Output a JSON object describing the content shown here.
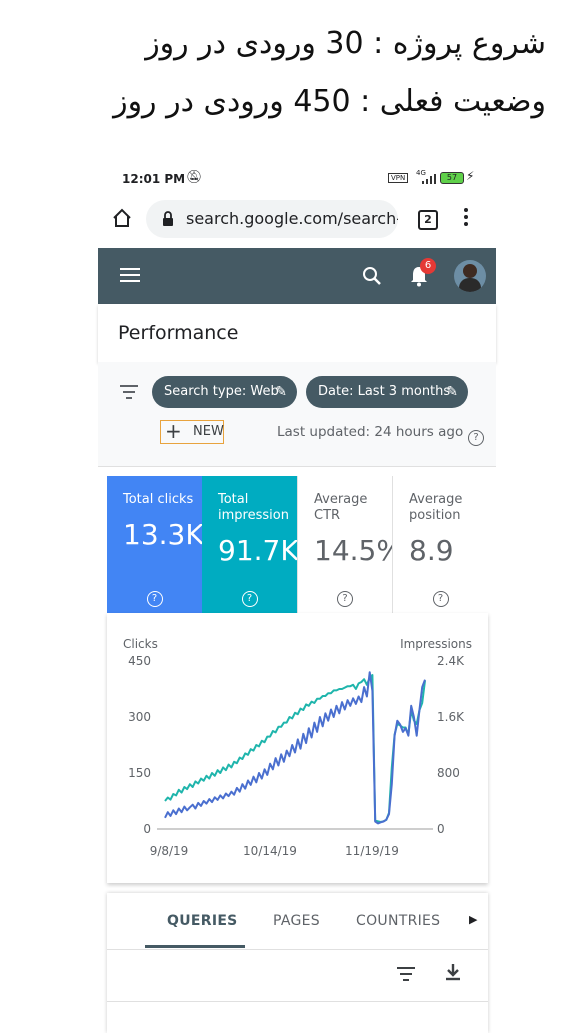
{
  "caption": {
    "line1": "شروع پروژه : 30 ورودی در روز",
    "line2": "وضعیت فعلی : 450  ورودی در روز"
  },
  "status": {
    "time": "12:01 PM",
    "battery": "57",
    "vpn": "VPN",
    "net": "4G"
  },
  "browser": {
    "url": "search.google.com/search-",
    "tab_count": "2"
  },
  "appbar": {
    "notification_count": "6"
  },
  "page": {
    "title": "Performance"
  },
  "filters": {
    "search_type": "Search type: Web",
    "date": "Date: Last 3 months",
    "new_label": "NEW",
    "last_updated": "Last updated: 24 hours ago"
  },
  "metrics": [
    {
      "label": "Total clicks",
      "value": "13.3K",
      "bg": "#4285f4",
      "fg": "#ffffff"
    },
    {
      "label": "Total impression",
      "value": "91.7K",
      "bg": "#00acc1",
      "fg": "#ffffff"
    },
    {
      "label": "Average CTR",
      "value": "14.5%",
      "bg": "#ffffff",
      "fg": "#5f6368"
    },
    {
      "label": "Average position",
      "value": "8.9",
      "bg": "#ffffff",
      "fg": "#5f6368"
    }
  ],
  "chart_data": {
    "type": "line",
    "ylabel_left": "Clicks",
    "ylabel_right": "Impressions",
    "left_ticks": [
      "450",
      "300",
      "150",
      "0"
    ],
    "right_ticks": [
      "2.4K",
      "1.6K",
      "800",
      "0"
    ],
    "x_ticks": [
      "9/8/19",
      "10/14/19",
      "11/19/19"
    ],
    "ylim_left": [
      0,
      450
    ],
    "ylim_right": [
      0,
      2400
    ],
    "series": [
      {
        "name": "Clicks",
        "color": "#4a6fcf",
        "axis": "left",
        "values": [
          30,
          45,
          35,
          50,
          40,
          55,
          45,
          60,
          50,
          58,
          65,
          55,
          70,
          62,
          75,
          68,
          80,
          72,
          85,
          78,
          90,
          82,
          95,
          88,
          100,
          92,
          110,
          100,
          120,
          108,
          130,
          118,
          140,
          125,
          150,
          135,
          160,
          145,
          175,
          160,
          190,
          170,
          200,
          180,
          210,
          195,
          225,
          205,
          240,
          215,
          255,
          230,
          270,
          245,
          285,
          260,
          300,
          275,
          310,
          290,
          320,
          300,
          330,
          310,
          340,
          320,
          345,
          330,
          350,
          335,
          355,
          340,
          380,
          355,
          420,
          370,
          20,
          15,
          18,
          20,
          25,
          40,
          120,
          250,
          290,
          280,
          260,
          270,
          250,
          330,
          300,
          250,
          320,
          380,
          400
        ]
      },
      {
        "name": "Impressions",
        "color": "#1fb5ac",
        "axis": "right",
        "values": [
          400,
          450,
          420,
          500,
          480,
          560,
          520,
          600,
          570,
          640,
          600,
          680,
          650,
          720,
          690,
          760,
          720,
          800,
          760,
          840,
          800,
          880,
          840,
          920,
          880,
          960,
          940,
          1020,
          1000,
          1080,
          1060,
          1140,
          1120,
          1200,
          1180,
          1260,
          1240,
          1320,
          1320,
          1400,
          1380,
          1460,
          1460,
          1520,
          1520,
          1600,
          1580,
          1660,
          1640,
          1720,
          1700,
          1780,
          1760,
          1820,
          1800,
          1860,
          1860,
          1900,
          1900,
          1940,
          1940,
          1980,
          1980,
          2000,
          2000,
          2020,
          2040,
          2040,
          2060,
          2000,
          2080,
          2100,
          2140,
          2060,
          2160,
          2200,
          120,
          110,
          100,
          110,
          130,
          230,
          880,
          1350,
          1500,
          1480,
          1450,
          1450,
          1350,
          1700,
          1550,
          1500,
          1700,
          1800,
          2120
        ]
      }
    ],
    "grid": false,
    "legend": "none"
  },
  "tabs": {
    "items": [
      "QUERIES",
      "PAGES",
      "COUNTRIES"
    ],
    "active": 0
  }
}
